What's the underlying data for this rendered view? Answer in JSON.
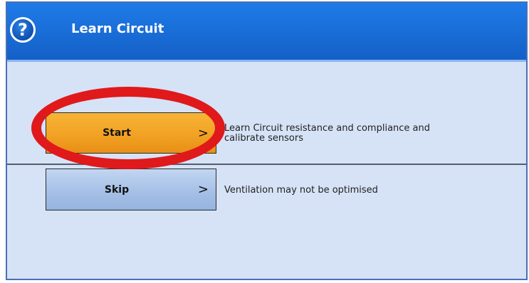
{
  "window": {
    "title": "Learn Circuit",
    "help_icon_glyph": "?"
  },
  "actions": {
    "start": {
      "label": "Start",
      "chevron": ">",
      "description": "Learn Circuit resistance and compliance and calibrate sensors"
    },
    "skip": {
      "label": "Skip",
      "chevron": ">",
      "description": "Ventilation may not be optimised"
    }
  },
  "colors": {
    "titlebar": "#1a6fd9",
    "body": "#d6e2f6",
    "start_button": "#f2a224",
    "skip_button": "#a6c0e6",
    "annotation_ring": "#e0191b"
  },
  "icons": [
    "help-icon",
    "chevron-right-icon"
  ]
}
